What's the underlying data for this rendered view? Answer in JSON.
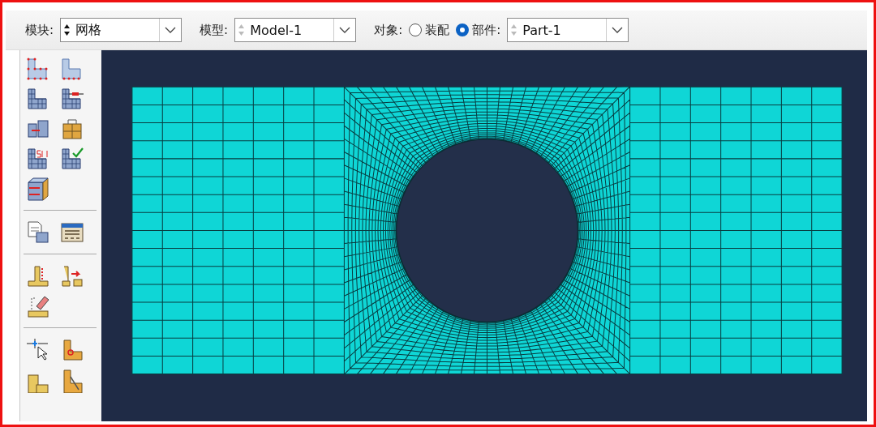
{
  "toolbar": {
    "module": {
      "label": "模块:",
      "value": "网格",
      "spin_disabled": false
    },
    "model": {
      "label": "模型:",
      "value": "Model-1",
      "spin_disabled": true
    },
    "object": {
      "label": "对象:",
      "options": [
        {
          "label": "装配",
          "selected": false
        },
        {
          "label": "部件:",
          "selected": true
        }
      ]
    },
    "part": {
      "value": "Part-1",
      "spin_disabled": true
    }
  }
}
